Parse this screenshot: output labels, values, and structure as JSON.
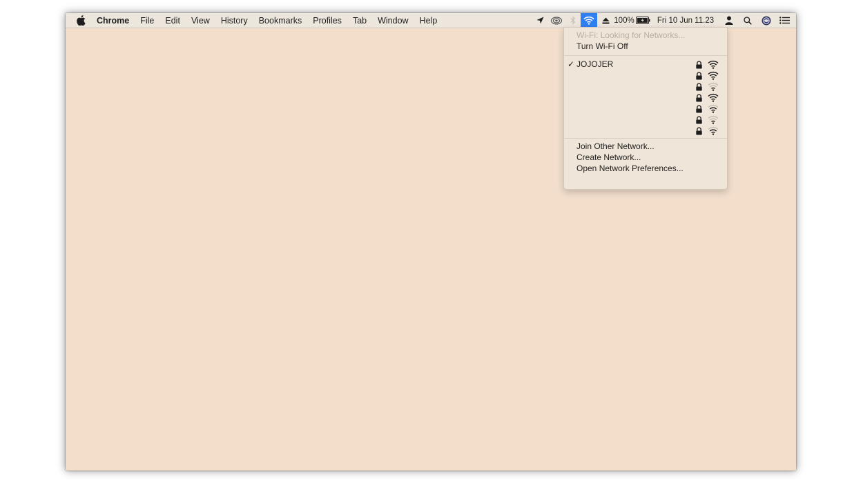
{
  "menubar": {
    "app_name": "Chrome",
    "menus": [
      "File",
      "Edit",
      "View",
      "History",
      "Bookmarks",
      "Profiles",
      "Tab",
      "Window",
      "Help"
    ],
    "battery_percent": "100%",
    "clock": "Fri 10 Jun  11.23",
    "wifi_active_color": "#2f7ff2",
    "icons": [
      "apple-icon",
      "location-arrow-icon",
      "cloud-sync-icon",
      "bluetooth-icon",
      "wifi-icon",
      "eject-icon",
      "battery-icon",
      "user-icon",
      "search-icon",
      "siri-icon",
      "notification-center-icon"
    ]
  },
  "wifi_menu": {
    "status": "Wi-Fi: Looking for Networks...",
    "toggle": "Turn Wi-Fi Off",
    "networks": [
      {
        "name": "JOJOJER",
        "connected": true,
        "locked": true,
        "signal": "full"
      },
      {
        "name": "",
        "connected": false,
        "locked": true,
        "signal": "full"
      },
      {
        "name": "",
        "connected": false,
        "locked": true,
        "signal": "weak"
      },
      {
        "name": "",
        "connected": false,
        "locked": true,
        "signal": "full"
      },
      {
        "name": "",
        "connected": false,
        "locked": true,
        "signal": "medium"
      },
      {
        "name": "",
        "connected": false,
        "locked": true,
        "signal": "weak"
      },
      {
        "name": "",
        "connected": false,
        "locked": true,
        "signal": "medium"
      }
    ],
    "check_mark": "✓",
    "join_other": "Join Other Network...",
    "create": "Create Network...",
    "open_prefs": "Open Network Preferences..."
  }
}
